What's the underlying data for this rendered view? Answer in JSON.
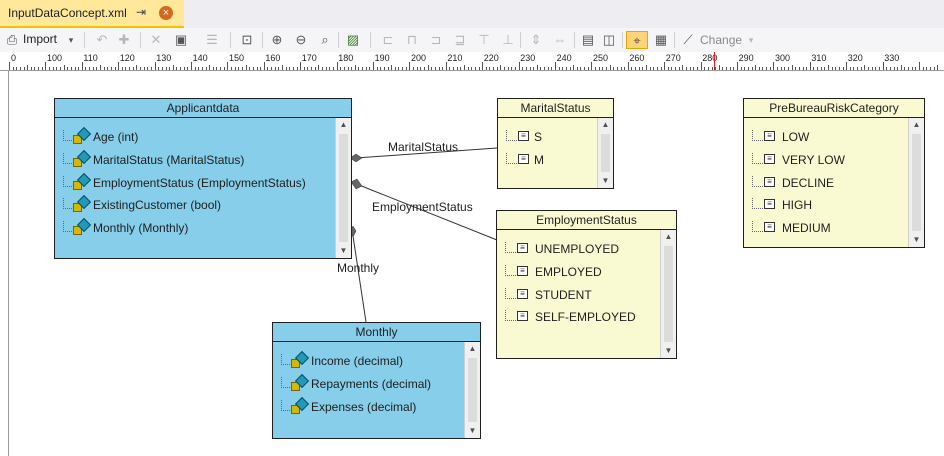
{
  "tab": {
    "title": "InputDataConcept.xml",
    "pin_glyph": "⇥",
    "close_glyph": "×"
  },
  "toolbar": {
    "import_label": "Import",
    "change_label": "Change",
    "dropdown_glyph": "▾"
  },
  "ruler": {
    "labels": [
      "0",
      "100",
      "110",
      "120",
      "130",
      "140",
      "150",
      "160",
      "170",
      "180",
      "190",
      "200",
      "210",
      "220",
      "230",
      "240",
      "250",
      "260",
      "270",
      "280",
      "290",
      "300",
      "310",
      "320",
      "330"
    ]
  },
  "boxes": {
    "applicantdata": {
      "title": "Applicantdata",
      "items": [
        "Age (int)",
        "MaritalStatus (MaritalStatus)",
        "EmploymentStatus (EmploymentStatus)",
        "ExistingCustomer (bool)",
        "Monthly (Monthly)"
      ]
    },
    "marital_status": {
      "title": "MaritalStatus",
      "items": [
        "S",
        "M"
      ]
    },
    "employment_status": {
      "title": "EmploymentStatus",
      "items": [
        "UNEMPLOYED",
        "EMPLOYED",
        "STUDENT",
        "SELF-EMPLOYED"
      ]
    },
    "prebureau": {
      "title": "PreBureauRiskCategory",
      "items": [
        "LOW",
        "VERY LOW",
        "DECLINE",
        "HIGH",
        "MEDIUM"
      ]
    },
    "monthly": {
      "title": "Monthly",
      "items": [
        "Income (decimal)",
        "Repayments (decimal)",
        "Expenses (decimal)"
      ]
    }
  },
  "connections": {
    "marital": "MaritalStatus",
    "employment": "EmploymentStatus",
    "monthly": "Monthly"
  },
  "scroll": {
    "up_glyph": "▲",
    "down_glyph": "▼"
  },
  "enum_glyph": "≡",
  "colors": {
    "class_box": "#87ceeb",
    "enum_box": "#fafad2",
    "tab_active": "#ffe89a",
    "tab_accent": "#f5c200"
  },
  "icons": {
    "field": "lock-diamond-field-icon",
    "enum_value": "enum-value-icon"
  }
}
